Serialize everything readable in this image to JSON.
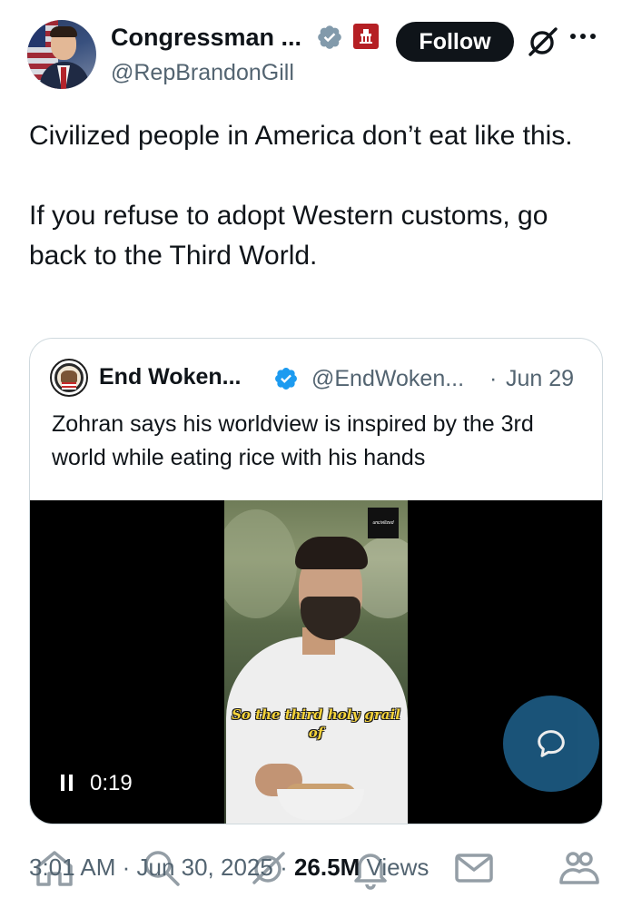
{
  "author": {
    "display_name": "Congressman ...",
    "handle": "@RepBrandonGill"
  },
  "follow_button": "Follow",
  "tweet": {
    "paragraphs": [
      "Civilized people in America don’t eat like this.",
      "If you refuse to adopt Western customs, go back to the Third World."
    ]
  },
  "quoted": {
    "display_name": "End Woken...",
    "handle": "@EndWoken...",
    "separator": "·",
    "date": "Jun 29",
    "text": "Zohran says his worldview is inspired by the 3rd world while eating rice with his hands",
    "video": {
      "caption": "So the third holy grail of",
      "watermark": "uncivilized",
      "elapsed": "0:19"
    }
  },
  "meta": {
    "time_date": "3:01 AM · Jun 30, 2025 · ",
    "views_count": "26.5M",
    "views_label": " Views"
  },
  "colors": {
    "verified_blue": "#1d9bf0",
    "follow_bg": "#0f1419",
    "gov_badge": "#b51f24",
    "caption_yellow": "#f4d23a",
    "reply_fab": "#1d5a82"
  },
  "icons": [
    "verified-icon",
    "government-badge-icon",
    "grok-icon",
    "more-icon",
    "pause-icon",
    "reply-icon",
    "home-icon",
    "search-icon",
    "grok-nav-icon",
    "notifications-icon",
    "messages-icon",
    "communities-icon"
  ]
}
